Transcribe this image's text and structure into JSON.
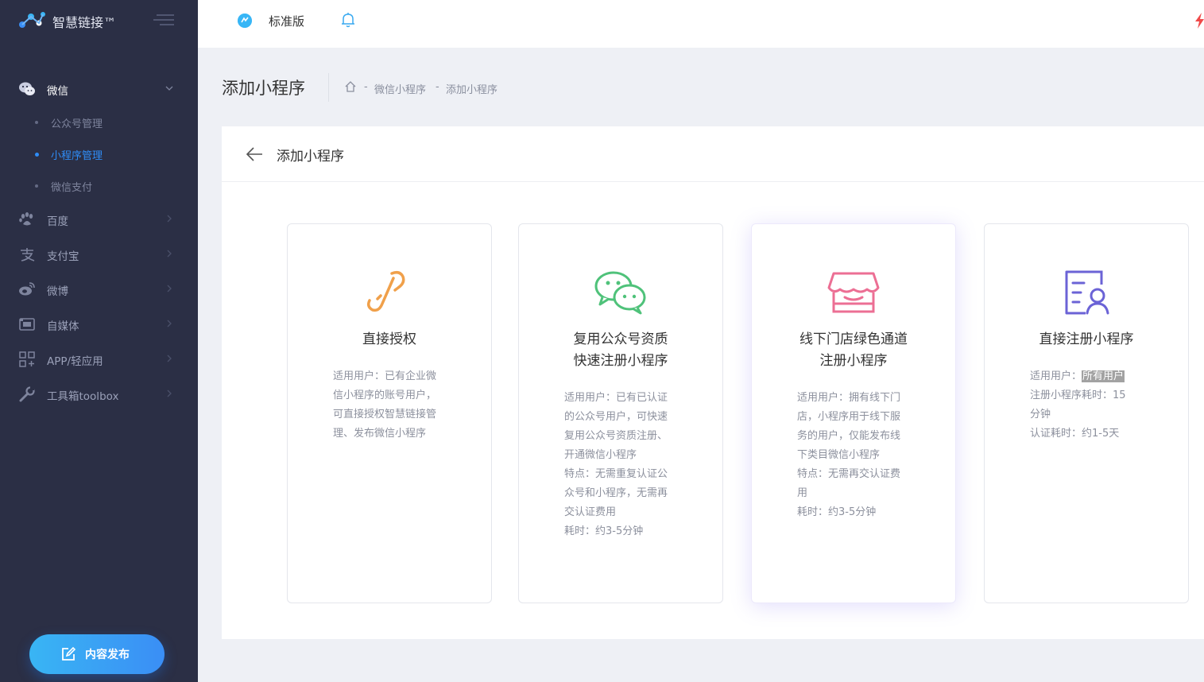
{
  "sidebar": {
    "logo_text": "智慧链接™",
    "groups": [
      {
        "label": "微信",
        "icon": "wechat-icon"
      },
      {
        "label": "百度",
        "icon": "paw-icon"
      },
      {
        "label": "支付宝",
        "icon": "alipay-icon"
      },
      {
        "label": "微博",
        "icon": "weibo-icon"
      },
      {
        "label": "自媒体",
        "icon": "media-icon"
      },
      {
        "label": "APP/轻应用",
        "icon": "app-grid-icon"
      },
      {
        "label": "工具箱toolbox",
        "icon": "wrench-icon"
      }
    ],
    "wechat_sub": [
      {
        "label": "公众号管理"
      },
      {
        "label": "小程序管理"
      },
      {
        "label": "微信支付"
      }
    ],
    "publish_label": "内容发布"
  },
  "header": {
    "edition_label": "标准版"
  },
  "page": {
    "title": "添加小程序",
    "breadcrumb": [
      "微信小程序",
      "添加小程序"
    ],
    "breadcrumb_sep": "-"
  },
  "panel": {
    "title": "添加小程序"
  },
  "cards": [
    {
      "title_lines": [
        "直接授权"
      ],
      "desc_lines": [
        "适用用户：已有企业微",
        "信小程序的账号用户，",
        "可直接授权智慧链接管",
        "理、发布微信小程序"
      ],
      "icon": "link-chain-icon",
      "color": "#f0a04a"
    },
    {
      "title_lines": [
        "复用公众号资质",
        "快速注册小程序"
      ],
      "desc_lines": [
        "适用用户：已有已认证",
        "的公众号用户，可快速",
        "复用公众号资质注册、",
        "开通微信小程序",
        "特点：无需重复认证公",
        "众号和小程序，无需再",
        "交认证费用",
        "耗时：约3-5分钟"
      ],
      "icon": "wechat-chat-icon",
      "color": "#4fc27a"
    },
    {
      "title_lines": [
        "线下门店绿色通道",
        "注册小程序"
      ],
      "desc_lines": [
        "适用用户：拥有线下门",
        "店，小程序用于线下服",
        "务的用户，仅能发布线",
        "下类目微信小程序",
        "特点：无需再交认证费",
        "用",
        "耗时：约3-5分钟"
      ],
      "icon": "store-icon",
      "color": "#ec6f94"
    },
    {
      "title_lines": [
        "直接注册小程序"
      ],
      "desc_label": "适用用户：",
      "desc_highlight": "所有用户",
      "desc_lines_rest": [
        "注册小程序耗时：15",
        "分钟",
        "认证耗时：约1-5天"
      ],
      "icon": "user-form-icon",
      "color": "#6b63d6"
    }
  ],
  "colors": {
    "sidebar_bg": "#2b2f45",
    "accent": "#2f8df7",
    "page_bg": "#eef0f5"
  }
}
